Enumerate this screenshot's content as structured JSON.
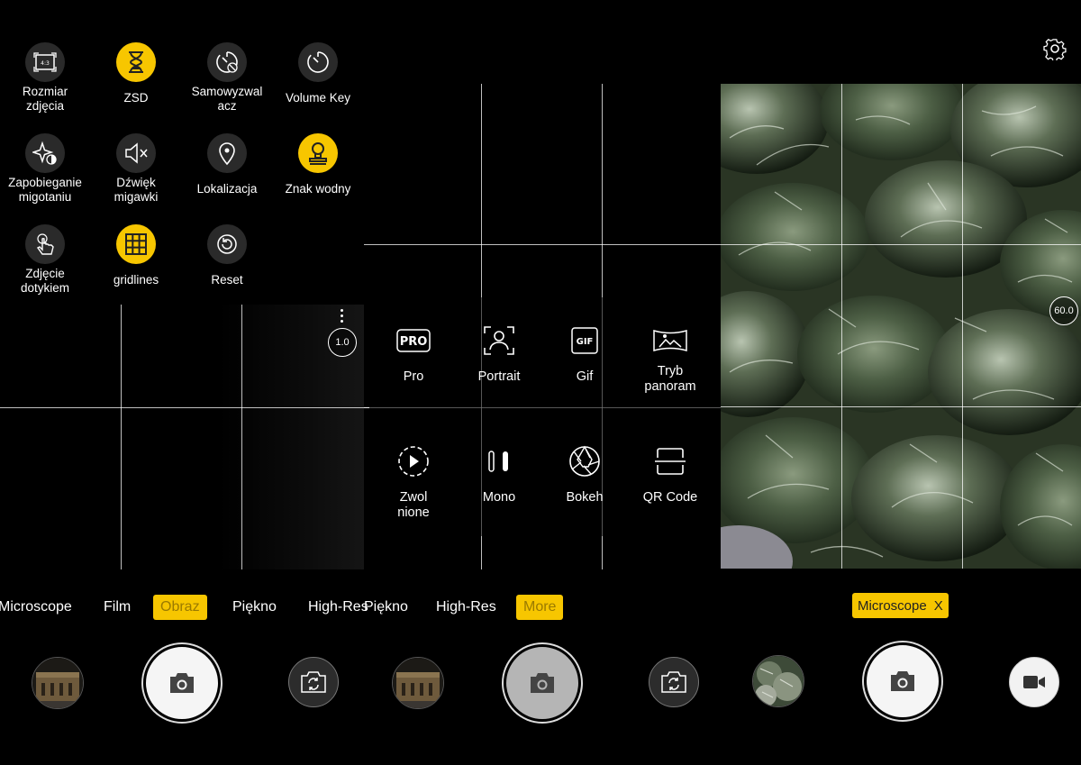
{
  "settings_panel": {
    "items": [
      {
        "label": "Rozmiar\nzdjęcia",
        "icon": "aspect-ratio-icon",
        "badge": "4:3",
        "active": false
      },
      {
        "label": "ZSD",
        "icon": "hourglass-icon",
        "active": true
      },
      {
        "label": "Samowyzwal\nacz",
        "icon": "self-timer-icon",
        "active": false
      },
      {
        "label": "Volume Key",
        "icon": "volume-key-icon",
        "active": false
      },
      {
        "label": "Zapobieganie\nmigotaniu",
        "icon": "anti-flicker-icon",
        "active": false
      },
      {
        "label": "Dźwięk\nmigawki",
        "icon": "shutter-sound-mute-icon",
        "active": false
      },
      {
        "label": "Lokalizacja",
        "icon": "location-pin-icon",
        "active": false
      },
      {
        "label": "Znak wodny",
        "icon": "watermark-stamp-icon",
        "active": true
      },
      {
        "label": "Zdjęcie\ndotykiem",
        "icon": "touch-capture-icon",
        "active": false
      },
      {
        "label": "gridlines",
        "icon": "grid-icon",
        "active": true
      },
      {
        "label": "Reset",
        "icon": "reset-icon",
        "active": false
      }
    ]
  },
  "more_modes": {
    "items": [
      {
        "label": "Pro",
        "icon": "pro-mode-icon",
        "icon_text": "PRO"
      },
      {
        "label": "Portrait",
        "icon": "portrait-icon"
      },
      {
        "label": "Gif",
        "icon": "gif-icon",
        "icon_text": "GIF"
      },
      {
        "label": "Tryb\npanoram",
        "icon": "panorama-icon"
      },
      {
        "label": "Zwol\nnione",
        "icon": "slow-motion-icon"
      },
      {
        "label": "Mono",
        "icon": "mono-icon"
      },
      {
        "label": "Bokeh",
        "icon": "aperture-icon"
      },
      {
        "label": "QR Code",
        "icon": "qr-scan-icon"
      }
    ]
  },
  "zoom_left": "1.0",
  "zoom_right": "60.0",
  "mode_bar_left": {
    "tabs": [
      "Microscope",
      "Film",
      "Obraz",
      "Piękno",
      "High-Res"
    ],
    "selected": "Obraz"
  },
  "mode_bar_mid": {
    "tabs": [
      "Piękno",
      "High-Res",
      "More"
    ],
    "selected": "More"
  },
  "mode_bar_right": {
    "active_mode": "Microscope",
    "close_label": "X"
  },
  "colors": {
    "accent": "#f7c600",
    "background": "#000000"
  }
}
